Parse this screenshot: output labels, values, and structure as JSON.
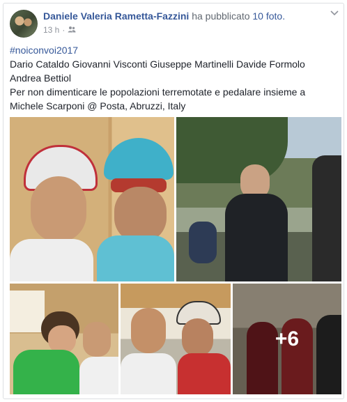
{
  "post": {
    "author": "Daniele Valeria Rametta-Fazzini",
    "action": "ha pubblicato",
    "photos_link": "10 foto.",
    "time": "13 h",
    "separator": "·",
    "audience_icon": "friends-icon",
    "hashtag": "#noiconvoi2017",
    "lines": [
      "Dario Cataldo Giovanni Visconti Giuseppe Martinelli Davide Formolo",
      "Andrea Bettiol",
      "Per non dimenticare le popolazioni terremotate e pedalare insieme a",
      "Michele Scarponi @ Posta, Abruzzi, Italy"
    ],
    "more_photos": "+6"
  },
  "colors": {
    "link": "#365899",
    "meta": "#90949c",
    "text": "#1d2129"
  }
}
